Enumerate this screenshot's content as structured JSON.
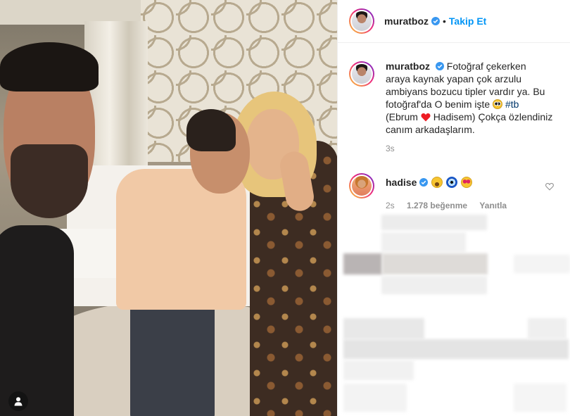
{
  "post": {
    "author": "muratboz",
    "follow_label": "Takip Et",
    "separator": "•"
  },
  "caption": {
    "username": "muratboz",
    "text_before_emoji": "Fotoğraf çekerken araya kaynak yapan çok arzulu ambiyans bozucu tipler vardır ya. Bu fotoğraf'da O benim işte",
    "hashtag": "#tb",
    "text_before_heart": "(Ebrum",
    "text_after_heart": "Hadisem) Çokça özlendiniz canım arkadaşlarım.",
    "time": "3s"
  },
  "comment": {
    "username": "hadise",
    "time": "2s",
    "likes": "1.278 beğenme",
    "reply": "Yanıtla",
    "emojis": [
      "smiling-face-icon",
      "nazar-amulet-icon",
      "heart-eyes-icon"
    ]
  },
  "colors": {
    "follow_blue": "#0095f6",
    "verified_blue": "#3897f0",
    "hashtag": "#00376b",
    "muted": "#8e8e8e",
    "heart_red": "#ed1c24"
  }
}
